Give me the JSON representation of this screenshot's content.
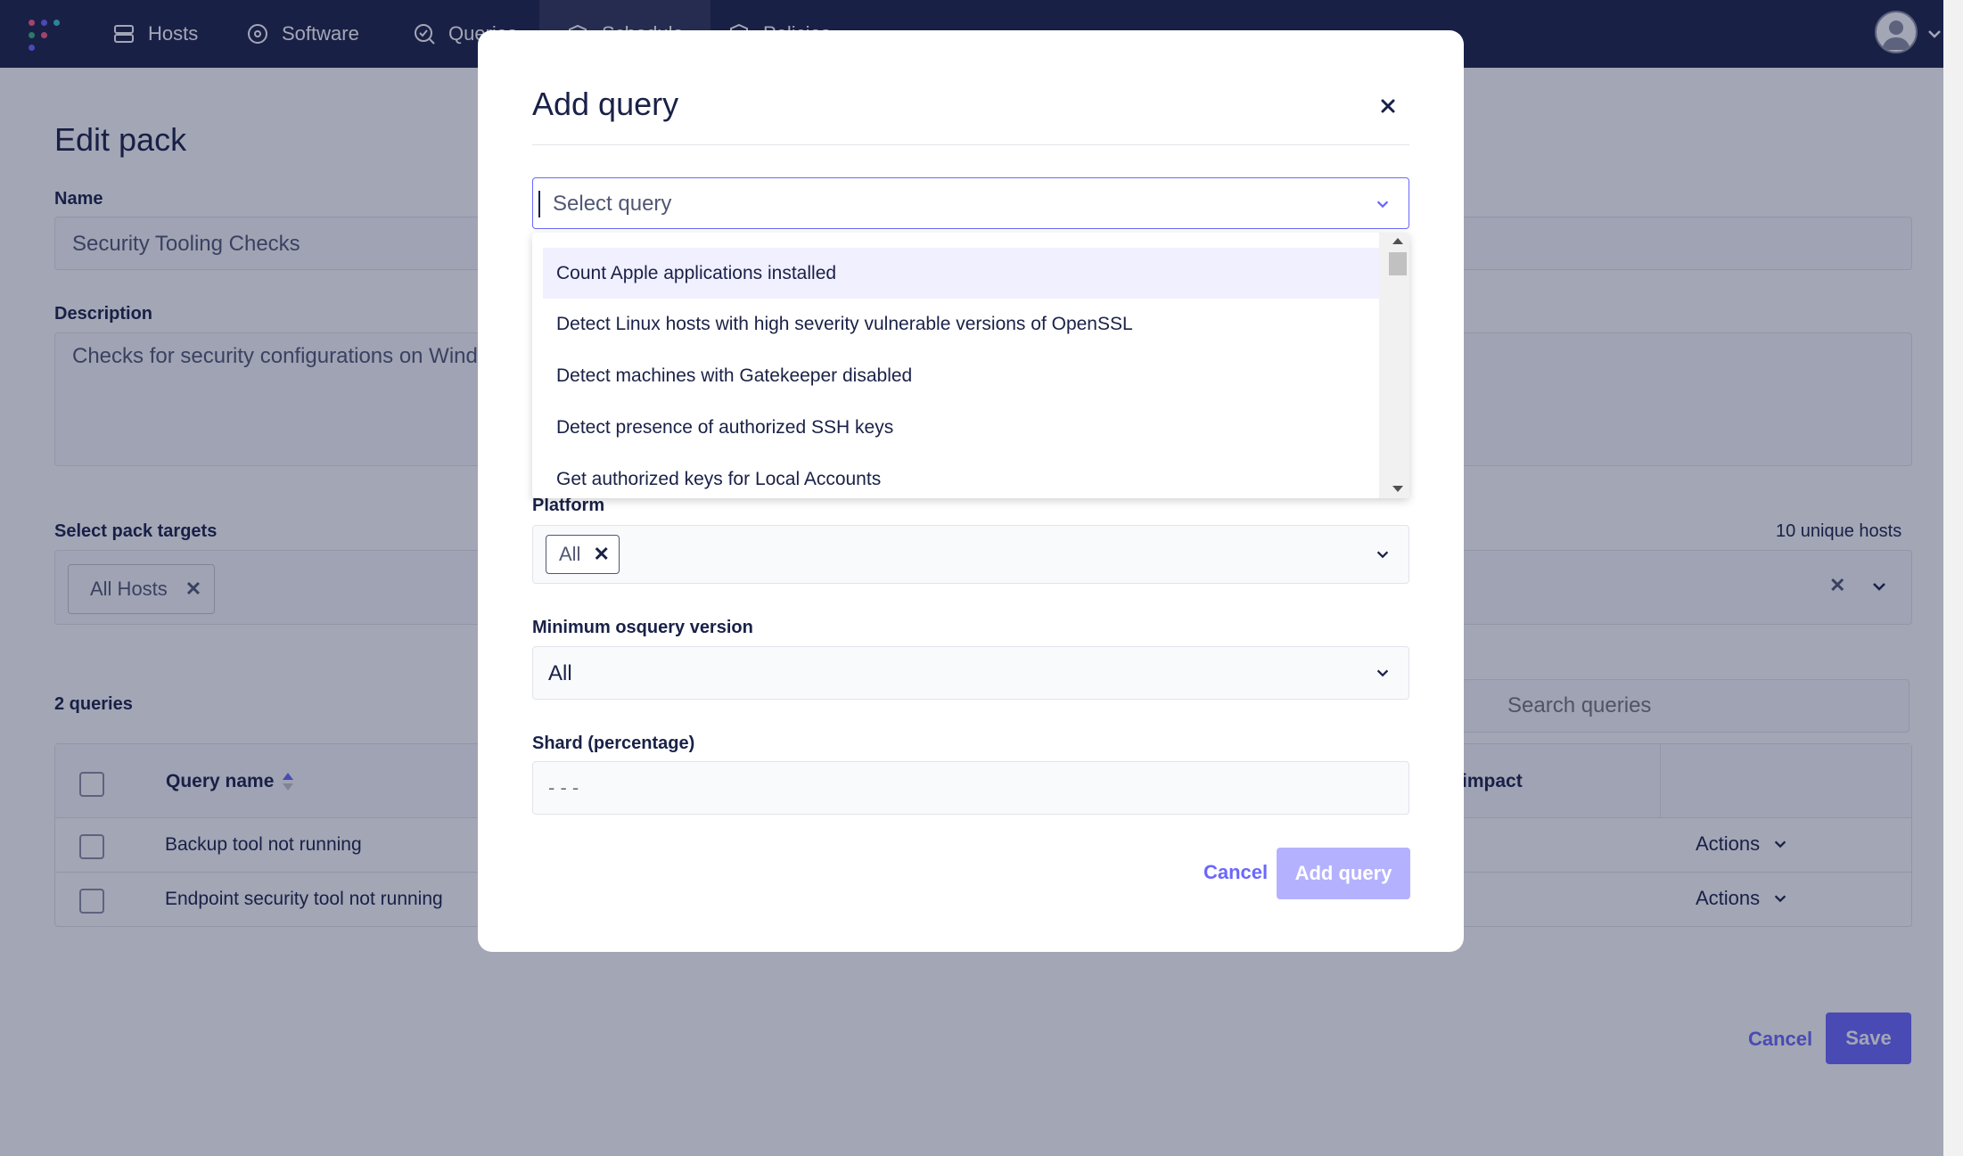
{
  "nav": {
    "items": [
      {
        "label": "Hosts",
        "icon": "hosts-icon"
      },
      {
        "label": "Software",
        "icon": "software-icon"
      },
      {
        "label": "Queries",
        "icon": "queries-icon"
      },
      {
        "label": "Schedule",
        "icon": "schedule-icon"
      },
      {
        "label": "Policies",
        "icon": "policies-icon"
      }
    ]
  },
  "page": {
    "title": "Edit pack",
    "name_label": "Name",
    "name_value": "Security Tooling Checks",
    "description_label": "Description",
    "description_value": "Checks for security configurations on Wind",
    "targets_label": "Select pack targets",
    "targets_count": "10 unique hosts",
    "target_chip": "All Hosts",
    "queries_count": "2 queries",
    "search_placeholder": "Search queries",
    "table": {
      "col_query_name": "Query name",
      "col_impact": "impact",
      "rows": [
        {
          "name": "Backup tool not running",
          "actions": "Actions"
        },
        {
          "name": "Endpoint security tool not running",
          "actions": "Actions"
        }
      ]
    },
    "cancel": "Cancel",
    "save": "Save"
  },
  "modal": {
    "title": "Add query",
    "select_placeholder": "Select query",
    "options": [
      "Count Apple applications installed",
      "Detect Linux hosts with high severity vulnerable versions of OpenSSL",
      "Detect machines with Gatekeeper disabled",
      "Detect presence of authorized SSH keys",
      "Get authorized keys for Local Accounts"
    ],
    "platform_label": "Platform",
    "platform_value": "All",
    "min_version_label": "Minimum osquery version",
    "min_version_value": "All",
    "shard_label": "Shard (percentage)",
    "shard_placeholder": "- - -",
    "cancel": "Cancel",
    "add": "Add query"
  },
  "colors": {
    "nav_bg": "#192147",
    "brand": "#6a67fe",
    "brand_disabled": "#b4b2fe",
    "text": "#192147"
  }
}
